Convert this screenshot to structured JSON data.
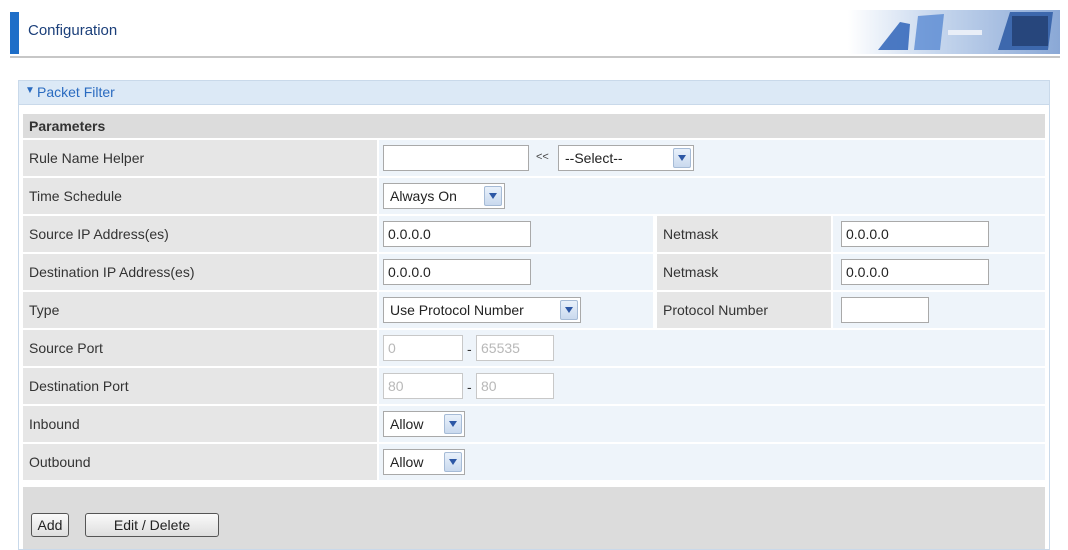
{
  "header": {
    "title": "Configuration"
  },
  "panel": {
    "title": "Packet Filter",
    "section": "Parameters"
  },
  "fields": {
    "rule_name": {
      "label": "Rule Name  Helper",
      "value": "",
      "arrows": "<<",
      "helper_select": "--Select--"
    },
    "time_schedule": {
      "label": "Time Schedule",
      "value": "Always On"
    },
    "source_ip": {
      "label": "Source IP Address(es)",
      "value": "0.0.0.0",
      "netmask_label": "Netmask",
      "netmask": "0.0.0.0"
    },
    "dest_ip": {
      "label": "Destination IP Address(es)",
      "value": "0.0.0.0",
      "netmask_label": "Netmask",
      "netmask": "0.0.0.0"
    },
    "type": {
      "label": "Type",
      "value": "Use Protocol Number",
      "protocol_label": "Protocol Number",
      "protocol_value": ""
    },
    "source_port": {
      "label": "Source Port",
      "from": "0",
      "to": "65535",
      "sep": "-"
    },
    "dest_port": {
      "label": "Destination Port",
      "from": "80",
      "to": "80",
      "sep": "-"
    },
    "inbound": {
      "label": "Inbound",
      "value": "Allow"
    },
    "outbound": {
      "label": "Outbound",
      "value": "Allow"
    }
  },
  "buttons": {
    "add": "Add",
    "edit_delete": "Edit / Delete"
  },
  "colors": {
    "accent": "#1e6ec8",
    "panel_title": "#2a6bc0",
    "header_text": "#1b3f7a"
  }
}
